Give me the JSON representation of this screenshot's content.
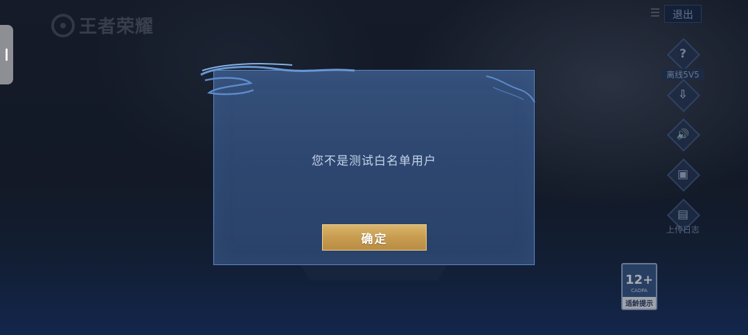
{
  "app": {
    "logo_text": "王者荣耀"
  },
  "top_right": {
    "exit_label": "退出"
  },
  "side_panel": {
    "items": [
      {
        "icon": "question-icon",
        "glyph": "?",
        "label": "离线5V5"
      },
      {
        "icon": "download-icon",
        "glyph": "⇩",
        "label": ""
      },
      {
        "icon": "speaker-icon",
        "glyph": "🔊",
        "label": ""
      },
      {
        "icon": "device-icon",
        "glyph": "▣",
        "label": ""
      },
      {
        "icon": "log-icon",
        "glyph": "▤",
        "label": "上传日志"
      }
    ]
  },
  "dialog": {
    "message": "您不是测试白名单用户",
    "confirm_label": "确定"
  },
  "age_rating": {
    "age": "12+",
    "org": "CADPA",
    "tip": "适龄提示"
  },
  "colors": {
    "button_gold": "#c89c4f",
    "modal_blue": "#2d4770",
    "modal_border": "#5f86bf"
  }
}
